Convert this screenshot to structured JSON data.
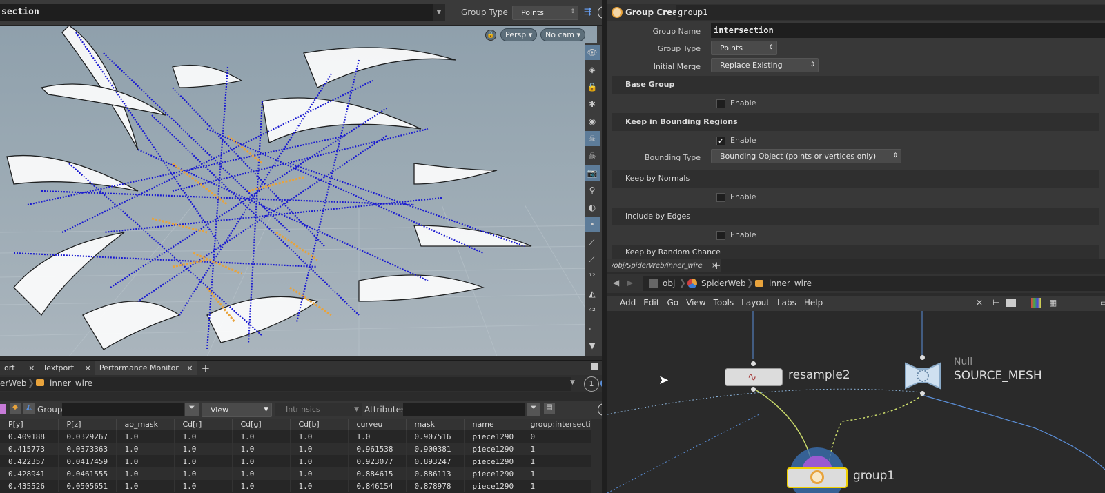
{
  "viewport": {
    "title": "section",
    "group_type_label": "Group Type",
    "group_type_value": "Points",
    "persp_label": "Persp",
    "cam_label": "No cam"
  },
  "spreadsheet": {
    "tabs": [
      "ort",
      "Textport",
      "Performance Monitor"
    ],
    "path": [
      "erWeb",
      "inner_wire"
    ],
    "page_number": "1",
    "group_label": "Group:",
    "view_label": "View",
    "intrinsics_label": "Intrinsics",
    "attributes_label": "Attributes:",
    "columns": [
      "P[y]",
      "P[z]",
      "ao_mask",
      "Cd[r]",
      "Cd[g]",
      "Cd[b]",
      "curveu",
      "mask",
      "name",
      "group:intersecti"
    ],
    "rows": [
      [
        "0.409188",
        "0.0329267",
        "1.0",
        "1.0",
        "1.0",
        "1.0",
        "1.0",
        "0.907516",
        "piece1290",
        "0"
      ],
      [
        "0.415773",
        "0.0373363",
        "1.0",
        "1.0",
        "1.0",
        "1.0",
        "0.961538",
        "0.900381",
        "piece1290",
        "1"
      ],
      [
        "0.422357",
        "0.0417459",
        "1.0",
        "1.0",
        "1.0",
        "1.0",
        "0.923077",
        "0.893247",
        "piece1290",
        "1"
      ],
      [
        "0.428941",
        "0.0461555",
        "1.0",
        "1.0",
        "1.0",
        "1.0",
        "0.884615",
        "0.886113",
        "piece1290",
        "1"
      ],
      [
        "0.435526",
        "0.0505651",
        "1.0",
        "1.0",
        "1.0",
        "1.0",
        "0.846154",
        "0.878978",
        "piece1290",
        "1"
      ]
    ]
  },
  "params": {
    "node_type": "Group Create",
    "node_name": "group1",
    "group_name_label": "Group Name",
    "group_name_value": "intersection",
    "group_type_label": "Group Type",
    "group_type_value": "Points",
    "initial_merge_label": "Initial Merge",
    "initial_merge_value": "Replace Existing",
    "base_group": "Base Group",
    "enable": "Enable",
    "keep_bounding": "Keep in Bounding Regions",
    "bounding_type_label": "Bounding Type",
    "bounding_type_value": "Bounding Object (points or vertices only)",
    "keep_normals": "Keep by Normals",
    "include_edges": "Include by Edges",
    "keep_random": "Keep by Random Chance"
  },
  "network": {
    "tab": "/obj/SpiderWeb/inner_wire",
    "path": [
      "obj",
      "SpiderWeb",
      "inner_wire"
    ],
    "menu": [
      "Add",
      "Edit",
      "Go",
      "View",
      "Tools",
      "Layout",
      "Labs",
      "Help"
    ],
    "nodes": {
      "resample": "resample2",
      "null_type": "Null",
      "null_name": "SOURCE_MESH",
      "group": "group1"
    }
  },
  "colors": {
    "accent_orange": "#e8a33c",
    "selected_yellow": "#f0d000",
    "point_blue": "#1a1ad0"
  }
}
